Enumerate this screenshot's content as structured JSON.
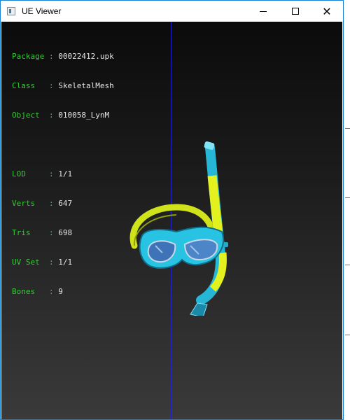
{
  "window": {
    "title": "UE Viewer"
  },
  "controls": {
    "minimize": "minimize",
    "maximize": "maximize",
    "close": "close"
  },
  "info": {
    "package": {
      "key": "Package",
      "sep": ":",
      "value": "00022412.upk"
    },
    "class": {
      "key": "Class  ",
      "sep": ":",
      "value": "SkeletalMesh"
    },
    "object": {
      "key": "Object ",
      "sep": ":",
      "value": "010058_LynM"
    },
    "lod": {
      "key": "LOD    ",
      "sep": ":",
      "value": "1/1"
    },
    "verts": {
      "key": "Verts  ",
      "sep": ":",
      "value": "647"
    },
    "tris": {
      "key": "Tris   ",
      "sep": ":",
      "value": "698"
    },
    "uvset": {
      "key": "UV Set ",
      "sep": ":",
      "value": "1/1"
    },
    "bones": {
      "key": "Bones  ",
      "sep": ":",
      "value": "9"
    }
  },
  "colors": {
    "label_green": "#39c739",
    "value_white": "#e6e6e6",
    "axis_blue": "#1b1fcc",
    "mesh_cyan": "#2ec9e6",
    "mesh_yellow": "#e3f21e"
  }
}
